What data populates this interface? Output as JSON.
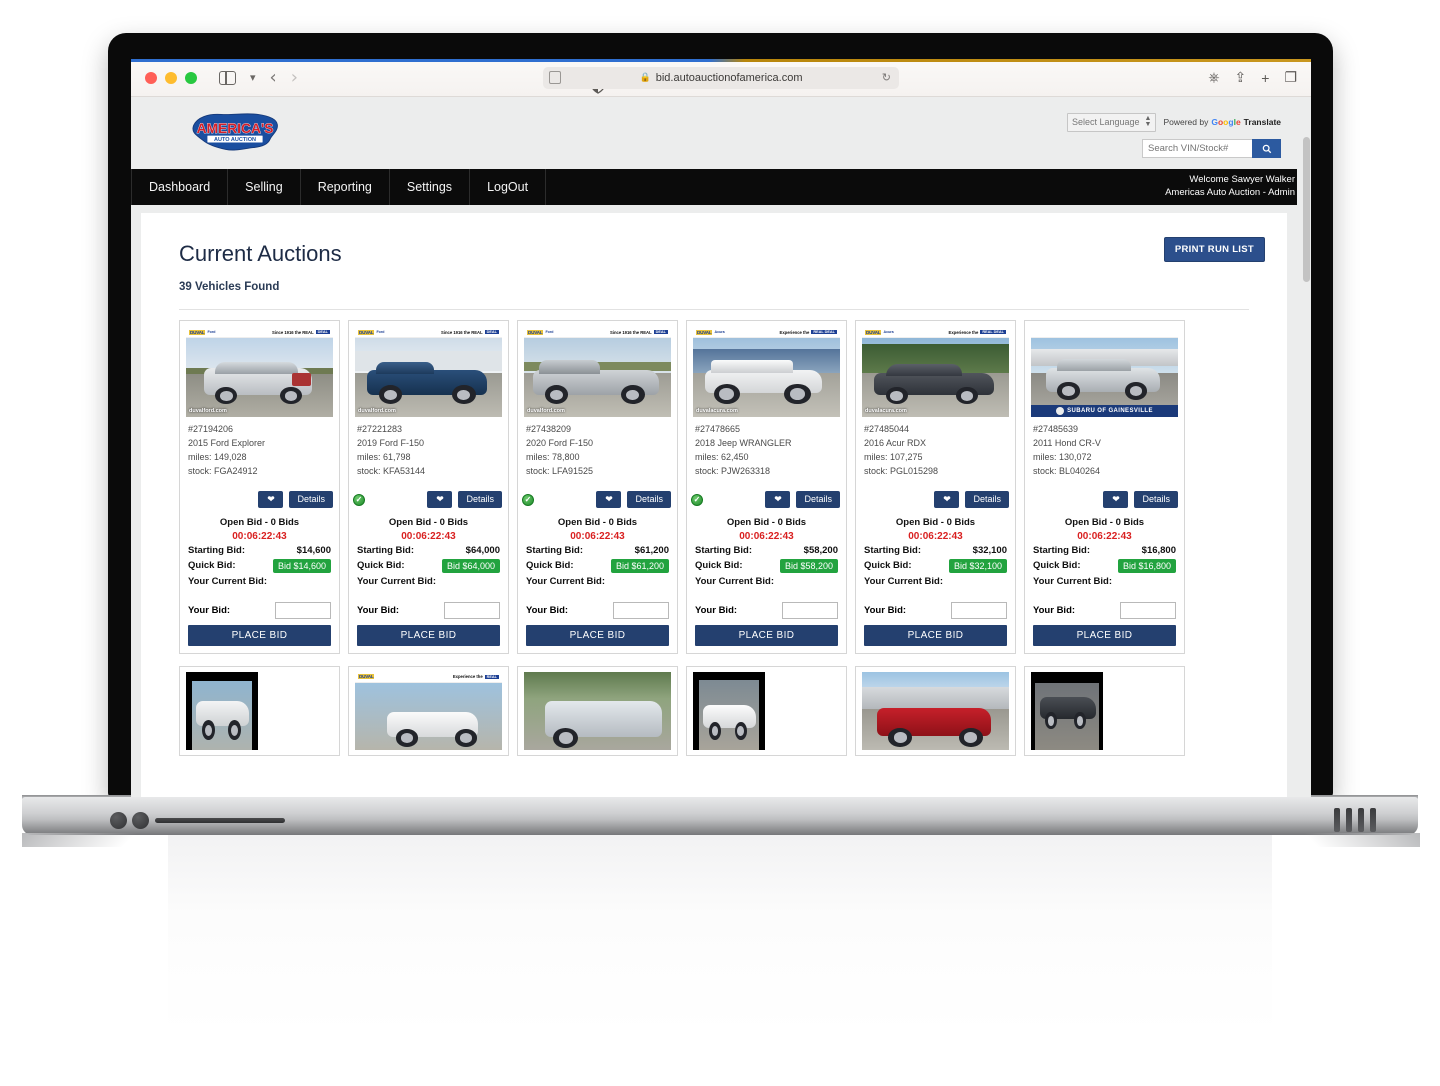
{
  "browser": {
    "url": "bid.autoauctionofamerica.com",
    "lock_icon": "lock-icon",
    "reload_icon": "reload-icon",
    "back_icon": "back-arrow-icon",
    "forward_icon": "forward-arrow-icon",
    "sidebar_icon": "sidebar-toggle-icon",
    "tabs_overview_icon": "tabs-overview-icon",
    "share_icon": "share-icon",
    "new_tab_icon": "new-tab-icon",
    "downloads_icon": "downloads-icon",
    "reader_icon": "reader-icon",
    "shield_icon": "privacy-shield-icon"
  },
  "header": {
    "logo_line1": "AMERICA'S",
    "logo_line2": "AUTO AUCTION",
    "language_select": "Select Language",
    "powered_by_pre": "Powered by",
    "google_letters": [
      "G",
      "o",
      "o",
      "g",
      "l",
      "e"
    ],
    "translate_label": "Translate",
    "search_placeholder": "Search VIN/Stock#",
    "search_value": "",
    "search_icon": "search-icon"
  },
  "nav": {
    "items": [
      {
        "label": "Dashboard"
      },
      {
        "label": "Selling"
      },
      {
        "label": "Reporting"
      },
      {
        "label": "Settings"
      },
      {
        "label": "LogOut"
      }
    ],
    "welcome": "Welcome Sawyer Walker",
    "org": "Americas Auto Auction - Admin"
  },
  "main": {
    "title": "Current Auctions",
    "print_button": "PRINT RUN LIST",
    "vehicles_found": "39 Vehicles Found",
    "labels": {
      "open_bid": "Open Bid - 0 Bids",
      "starting_bid": "Starting Bid:",
      "quick_bid": "Quick Bid:",
      "your_current_bid": "Your Current Bid:",
      "your_bid": "Your Bid:",
      "place_bid": "PLACE BID",
      "details": "Details",
      "heart_icon": "favorite-heart-icon",
      "check_icon": "verified-check-icon"
    },
    "colors": {
      "accent_blue": "#24406f",
      "quick_bid_green": "#22a33f",
      "timer_red": "#d92121",
      "nav_black": "#0b0b0b",
      "page_bg": "#eceded"
    },
    "vehicles": [
      {
        "stock_number": "#27194206",
        "name": "2015 Ford Explorer",
        "miles": "miles: 149,028",
        "stock": "stock: FGA24912",
        "banner_dealer": "DUVAL",
        "banner_sub": "Ford",
        "banner_tagline": "Since 1916 the REAL",
        "banner_badge": "DEAL",
        "watermark": "duvalford.com",
        "verified": false,
        "timer": "00:06:22:43",
        "starting_bid": "$14,600",
        "quick_bid": "Bid $14,600",
        "current_bid": "",
        "your_bid_value": ""
      },
      {
        "stock_number": "#27221283",
        "name": "2019 Ford F-150",
        "miles": "miles: 61,798",
        "stock": "stock: KFA53144",
        "banner_dealer": "DUVAL",
        "banner_sub": "Ford",
        "banner_tagline": "Since 1916 the REAL",
        "banner_badge": "DEAL",
        "watermark": "duvalford.com",
        "verified": true,
        "timer": "00:06:22:43",
        "starting_bid": "$64,000",
        "quick_bid": "Bid $64,000",
        "current_bid": "",
        "your_bid_value": ""
      },
      {
        "stock_number": "#27438209",
        "name": "2020 Ford F-150",
        "miles": "miles: 78,800",
        "stock": "stock: LFA91525",
        "banner_dealer": "DUVAL",
        "banner_sub": "Ford",
        "banner_tagline": "Since 1916 the REAL",
        "banner_badge": "DEAL",
        "watermark": "duvalford.com",
        "verified": true,
        "timer": "00:06:22:43",
        "starting_bid": "$61,200",
        "quick_bid": "Bid $61,200",
        "current_bid": "",
        "your_bid_value": ""
      },
      {
        "stock_number": "#27478665",
        "name": "2018 Jeep WRANGLER",
        "miles": "miles: 62,450",
        "stock": "stock: PJW263318",
        "banner_dealer": "DUVAL",
        "banner_sub": "Acura",
        "banner_tagline": "Experience the",
        "banner_badge": "REAL DEAL",
        "watermark": "duvalacura.com",
        "verified": true,
        "timer": "00:06:22:43",
        "starting_bid": "$58,200",
        "quick_bid": "Bid $58,200",
        "current_bid": "",
        "your_bid_value": ""
      },
      {
        "stock_number": "#27485044",
        "name": "2016 Acur RDX",
        "miles": "miles: 107,275",
        "stock": "stock: PGL015298",
        "banner_dealer": "DUVAL",
        "banner_sub": "Acura",
        "banner_tagline": "Experience the",
        "banner_badge": "REAL DEAL",
        "watermark": "duvalacura.com",
        "verified": false,
        "timer": "00:06:22:43",
        "starting_bid": "$32,100",
        "quick_bid": "Bid $32,100",
        "current_bid": "",
        "your_bid_value": ""
      },
      {
        "stock_number": "#27485639",
        "name": "2011 Hond CR-V",
        "miles": "miles: 130,072",
        "stock": "stock: BL040264",
        "banner_dealer": "",
        "banner_sub": "",
        "banner_tagline": "",
        "banner_badge": "",
        "watermark": "",
        "sub_banner": "SUBARU OF GAINESVILLE",
        "verified": false,
        "timer": "00:06:22:43",
        "starting_bid": "$16,800",
        "quick_bid": "Bid $16,800",
        "current_bid": "",
        "your_bid_value": ""
      }
    ],
    "second_row": [
      {
        "layout": "narrow",
        "alt": "white-minivan-thumbnail"
      },
      {
        "layout": "wide",
        "alt": "white-suv-dealership-photo"
      },
      {
        "layout": "wide",
        "alt": "silver-minivan-photo"
      },
      {
        "layout": "narrow",
        "alt": "white-van-thumbnail"
      },
      {
        "layout": "wide",
        "alt": "red-suv-subaru-dealership-photo"
      },
      {
        "layout": "narrow",
        "alt": "dark-suv-thumbnail"
      }
    ]
  }
}
